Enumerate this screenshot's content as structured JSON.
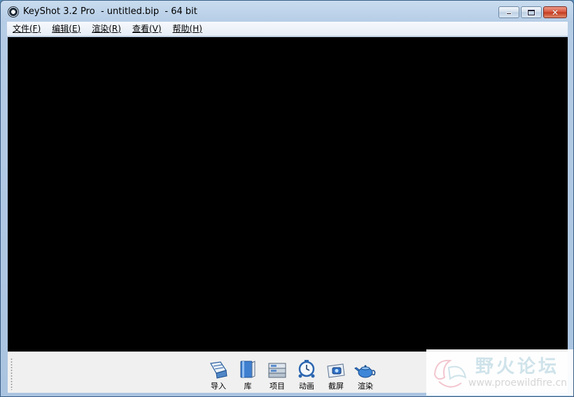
{
  "window": {
    "title": "KeyShot 3.2 Pro  - untitled.bip  - 64 bit",
    "controls": {
      "minimize": "minimize-icon",
      "maximize": "maximize-icon",
      "close": "close-icon"
    }
  },
  "menu": [
    {
      "label": "文件(F)"
    },
    {
      "label": "编辑(E)"
    },
    {
      "label": "渲染(R)"
    },
    {
      "label": "查看(V)"
    },
    {
      "label": "帮助(H)"
    }
  ],
  "toolbar": {
    "items": [
      {
        "label": "导入",
        "icon": "import-icon"
      },
      {
        "label": "库",
        "icon": "library-icon"
      },
      {
        "label": "项目",
        "icon": "project-icon"
      },
      {
        "label": "动画",
        "icon": "animation-icon"
      },
      {
        "label": "截屏",
        "icon": "screenshot-icon"
      },
      {
        "label": "渲染",
        "icon": "render-teapot-icon"
      }
    ]
  },
  "watermark": {
    "title": "野火论坛",
    "url": "www.proewildfire.cn"
  },
  "colors": {
    "viewport": "#000000",
    "titlebar": "#b6cde6",
    "toolbar": "#f0f0f0"
  }
}
